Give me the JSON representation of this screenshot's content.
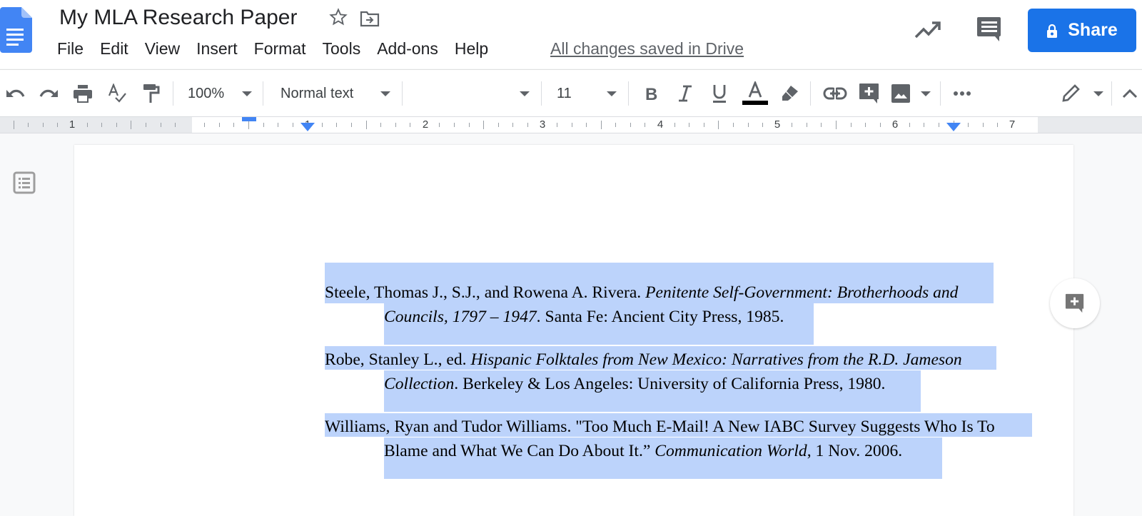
{
  "header": {
    "title": "My MLA Research Paper",
    "save_status": "All changes saved in Drive",
    "share_label": "Share",
    "menu": [
      "File",
      "Edit",
      "View",
      "Insert",
      "Format",
      "Tools",
      "Add-ons",
      "Help"
    ]
  },
  "toolbar": {
    "zoom": "100%",
    "style": "Normal text",
    "font": "",
    "font_size": "11",
    "text_color": "#000000"
  },
  "ruler": {
    "numbers": [
      "1",
      "1",
      "2",
      "3",
      "4",
      "5",
      "6",
      "7"
    ]
  },
  "document": {
    "selection_color": "#bcd3fb",
    "entries": [
      {
        "line1_plain": "Steele, Thomas J., S.J., and Rowena A. Rivera. ",
        "line1_italic": "Penitente Self-Government: Brotherhoods and",
        "line2_italic": "Councils, 1797 – 1947",
        "line2_plain": ". Santa Fe: Ancient City Press, 1985."
      },
      {
        "line1_plain": "Robe, Stanley L., ed. ",
        "line1_italic": "Hispanic Folktales from New Mexico: Narratives from the R.D. Jameson",
        "line2_italic": "Collection",
        "line2_plain": ". Berkeley & Los Angeles: University of California Press, 1980."
      },
      {
        "line1_plain": "Williams, Ryan and Tudor Williams. \"Too Much E-Mail! A New IABC Survey Suggests Who Is To",
        "line2_plain_pre": "Blame and What We Can Do About It.” ",
        "line2_italic": "Communication World",
        "line2_plain": ", 1 Nov. 2006."
      }
    ]
  },
  "colors": {
    "accent": "#1a73e8",
    "icon": "#5f6368"
  }
}
